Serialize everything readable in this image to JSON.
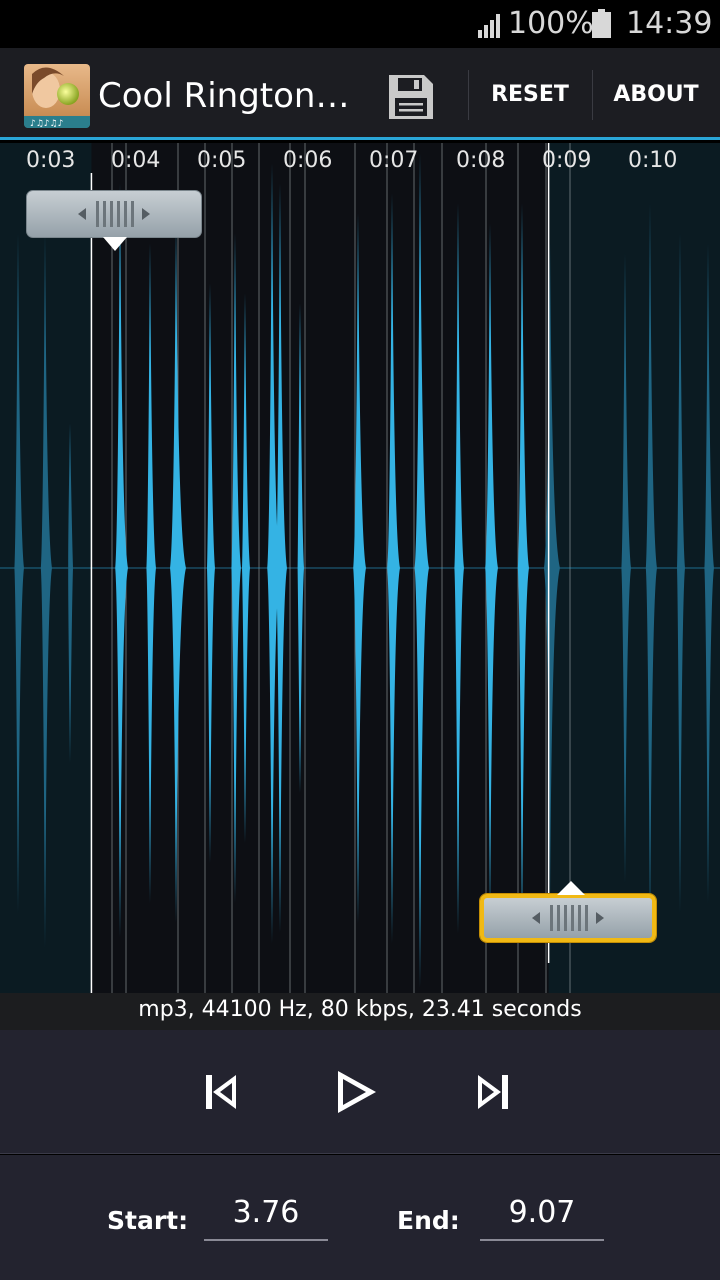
{
  "status_bar": {
    "battery": "100%",
    "time": "14:39"
  },
  "action_bar": {
    "title": "Cool Rington…",
    "save_icon": "save-icon",
    "reset_label": "RESET",
    "about_label": "ABOUT"
  },
  "waveform": {
    "time_ticks": [
      "0:03",
      "0:04",
      "0:05",
      "0:06",
      "0:07",
      "0:08",
      "0:09",
      "0:10"
    ],
    "selection_start_seconds": 3.76,
    "selection_end_seconds": 9.07,
    "colors": {
      "selected": "#34b3e4",
      "unselected": "#1f6583",
      "background": "#0b1b22"
    }
  },
  "file_info": "mp3, 44100 Hz, 80 kbps, 23.41 seconds",
  "playback": {
    "prev_icon": "skip-previous-icon",
    "play_icon": "play-icon",
    "next_icon": "skip-next-icon"
  },
  "bounds": {
    "start_label": "Start:",
    "start_value": "3.76",
    "end_label": "End:",
    "end_value": "9.07"
  },
  "colors": {
    "accent": "#2aa6d8",
    "handle_active_border": "#f1b914"
  }
}
